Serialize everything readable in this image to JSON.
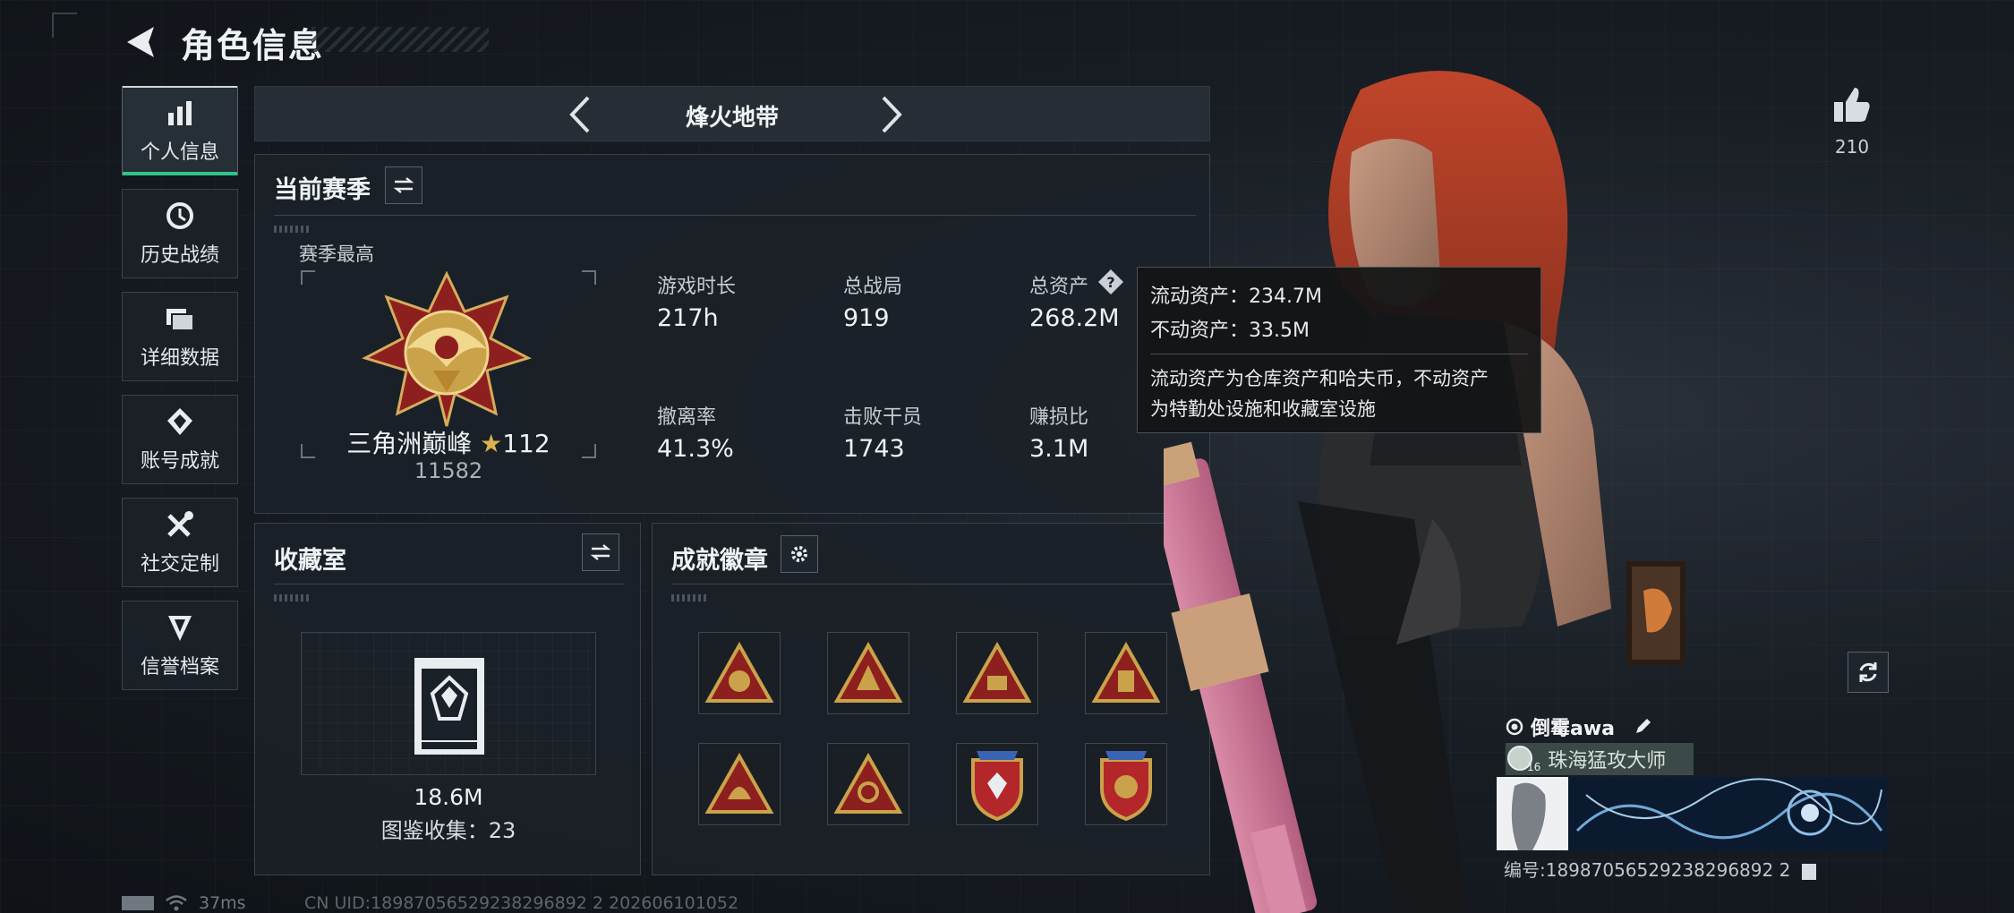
{
  "header": {
    "title": "角色信息"
  },
  "sidebar": {
    "items": [
      {
        "label": "个人信息",
        "icon": "bar-chart-icon",
        "active": true
      },
      {
        "label": "历史战绩",
        "icon": "history-icon"
      },
      {
        "label": "详细数据",
        "icon": "folder-icon"
      },
      {
        "label": "账号成就",
        "icon": "achievement-icon"
      },
      {
        "label": "社交定制",
        "icon": "tools-icon"
      },
      {
        "label": "信誉档案",
        "icon": "reputation-icon"
      }
    ]
  },
  "mode": {
    "label": "烽火地带"
  },
  "season": {
    "title": "当前赛季",
    "best_label": "赛季最高",
    "rank_name": "三角洲巅峰",
    "rank_stars": "112",
    "rank_score": "11582",
    "stats": [
      {
        "label": "游戏时长",
        "value": "217h"
      },
      {
        "label": "总战局",
        "value": "919"
      },
      {
        "label": "总资产",
        "value": "268.2M"
      },
      {
        "label": "撤离率",
        "value": "41.3%"
      },
      {
        "label": "击败干员",
        "value": "1743"
      },
      {
        "label": "赚损比",
        "value": "3.1M"
      }
    ]
  },
  "tooltip": {
    "liquid": "流动资产：234.7M",
    "fixed": "不动资产：33.5M",
    "desc_line1": "流动资产为仓库资产和哈夫币，不动资产",
    "desc_line2": "为特勤处设施和收藏室设施"
  },
  "collection": {
    "title": "收藏室",
    "value": "18.6M",
    "count": "图鉴收集：23"
  },
  "badges": {
    "title": "成就徽章",
    "items": [
      "badge-1",
      "badge-2",
      "badge-3",
      "badge-4",
      "badge-5",
      "badge-6",
      "badge-7",
      "badge-8"
    ]
  },
  "profile": {
    "likes": "210",
    "player_name": "倒霉awa",
    "player_title": "珠海猛攻大师",
    "player_level": "16",
    "player_id": "编号:18987056529238296892 2"
  },
  "status": {
    "ping": "37ms",
    "uid": "CN UID:18987056529238296892 2 202606101052"
  },
  "colors": {
    "accent_green": "#2ec48a",
    "panel_bg": "#1b2128",
    "badge_gold": "#c9a24a",
    "badge_red": "#8e1f1f"
  }
}
